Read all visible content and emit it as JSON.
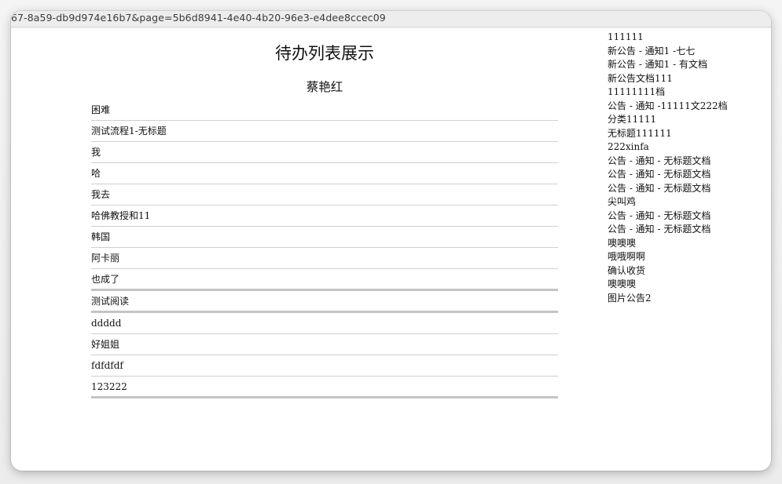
{
  "browser": {
    "url": "67-8a59-db9d974e16b7&page=5b6d8941-4e40-4b20-96e3-e4dee8ccec09"
  },
  "page": {
    "title": "待办列表展示",
    "user_name": "蔡艳红"
  },
  "todo_items": [
    {
      "label": "困难"
    },
    {
      "label": "测试流程1-无标题"
    },
    {
      "label": "我"
    },
    {
      "label": "哈"
    },
    {
      "label": "我去"
    },
    {
      "label": "哈佛教授和11"
    },
    {
      "label": "韩国"
    },
    {
      "label": "阿卡丽"
    },
    {
      "label": "也成了"
    },
    {
      "label": "测试阅读"
    },
    {
      "label": "ddddd"
    },
    {
      "label": "好姐姐"
    },
    {
      "label": "fdfdfdf"
    },
    {
      "label": "123222"
    }
  ],
  "notices": [
    {
      "label": "111111"
    },
    {
      "label": "新公告 - 通知1 -七七"
    },
    {
      "label": "新公告 - 通知1 - 有文档"
    },
    {
      "label": "新公告文档111"
    },
    {
      "label": "11111111档"
    },
    {
      "label": "公告 - 通知 -11111文222档"
    },
    {
      "label": "分类11111"
    },
    {
      "label": "无标题111111"
    },
    {
      "label": "222xinfa"
    },
    {
      "label": "公告 - 通知 - 无标题文档"
    },
    {
      "label": "公告 - 通知 - 无标题文档"
    },
    {
      "label": "公告 - 通知 - 无标题文档"
    },
    {
      "label": "尖叫鸡"
    },
    {
      "label": "公告 - 通知 - 无标题文档"
    },
    {
      "label": "公告 - 通知 - 无标题文档"
    },
    {
      "label": "噢噢噢"
    },
    {
      "label": "哦哦啊啊"
    },
    {
      "label": "确认收货"
    },
    {
      "label": "噢噢噢"
    },
    {
      "label": "图片公告2"
    }
  ]
}
